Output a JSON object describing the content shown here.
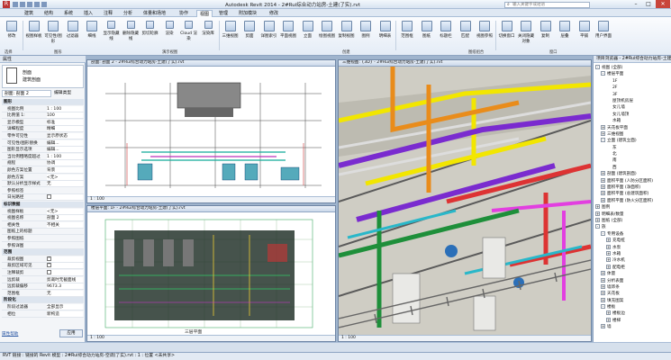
{
  "titlebar": {
    "title": "Autodesk Revit 2014 - 2#Rui综合动力站房-土建(了实).rvt",
    "search_placeholder": "输入关键字或短语",
    "minimize": "–",
    "maximize": "□",
    "close": "✕"
  },
  "tabs": [
    "建筑",
    "结构",
    "系统",
    "插入",
    "注释",
    "分析",
    "体量和场地",
    "协作",
    "视图",
    "管理",
    "附加模块",
    "修改"
  ],
  "active_tab": "视图",
  "ribbon": {
    "buttons": [
      {
        "label": "修改",
        "icon": "cursor-icon"
      },
      {
        "label": "视图样板",
        "icon": "template-icon"
      },
      {
        "label": "可见性/图形",
        "icon": "visibility-icon"
      },
      {
        "label": "过滤器",
        "icon": "filter-icon"
      },
      {
        "label": "细线",
        "icon": "thin-lines-icon"
      },
      {
        "label": "显示隐藏线",
        "icon": "show-hidden-icon"
      },
      {
        "label": "删除隐藏线",
        "icon": "remove-hidden-icon"
      },
      {
        "label": "剪切轮廓",
        "icon": "cut-profile-icon"
      },
      {
        "label": "渲染",
        "icon": "render-icon"
      },
      {
        "label": "Cloud 渲染",
        "icon": "cloud-icon"
      },
      {
        "label": "渲染库",
        "icon": "gallery-icon"
      },
      {
        "label": "三维视图",
        "icon": "3d-view-icon"
      },
      {
        "label": "剪面",
        "icon": "section-icon"
      },
      {
        "label": "详图索引",
        "icon": "callout-icon"
      },
      {
        "label": "平面视图",
        "icon": "plan-view-icon"
      },
      {
        "label": "立面",
        "icon": "elevation-icon"
      },
      {
        "label": "绘图视图",
        "icon": "drafting-icon"
      },
      {
        "label": "复制视图",
        "icon": "duplicate-icon"
      },
      {
        "label": "图例",
        "icon": "legend-icon"
      },
      {
        "label": "明细表",
        "icon": "schedule-icon"
      },
      {
        "label": "范围框",
        "icon": "scope-box-icon"
      },
      {
        "label": "图纸",
        "icon": "sheet-icon"
      },
      {
        "label": "标题栏",
        "icon": "titleblock-icon"
      },
      {
        "label": "匹配",
        "icon": "matchline-icon"
      },
      {
        "label": "视图参照",
        "icon": "view-reference-icon"
      },
      {
        "label": "切换窗口",
        "icon": "switch-window-icon"
      },
      {
        "label": "关闭隐藏对象",
        "icon": "close-hidden-icon"
      },
      {
        "label": "复制",
        "icon": "replicate-icon"
      },
      {
        "label": "层叠",
        "icon": "cascade-icon"
      },
      {
        "label": "平铺",
        "icon": "tile-icon"
      },
      {
        "label": "用户界面",
        "icon": "ui-icon"
      }
    ],
    "panels": [
      "选择",
      "图形",
      "演示视图",
      "创建",
      "图纸组合",
      "窗口"
    ]
  },
  "properties": {
    "header": "属性",
    "type_name": "剖面",
    "type_sub": "建筑剖面",
    "selector": "剖面: 剖面 2",
    "edit_type": "编辑类型",
    "help": "属性帮助",
    "apply": "应用",
    "rows": [
      {
        "group": true,
        "k": "图形"
      },
      {
        "k": "视图比例",
        "v": "1 : 100"
      },
      {
        "k": "比例值 1:",
        "v": "100"
      },
      {
        "k": "显示模型",
        "v": "标准"
      },
      {
        "k": "详细程度",
        "v": "精细"
      },
      {
        "k": "零件可见性",
        "v": "显示原状态"
      },
      {
        "k": "可见性/图形替换",
        "v": "编辑..."
      },
      {
        "k": "图形显示选项",
        "v": "编辑..."
      },
      {
        "k": "当比例粗略度超过",
        "v": "1 : 100"
      },
      {
        "k": "规程",
        "v": "协调"
      },
      {
        "k": "颜色方案位置",
        "v": "背景"
      },
      {
        "k": "颜色方案",
        "v": "<无>"
      },
      {
        "k": "默认分析显示样式",
        "v": "无"
      },
      {
        "k": "参照标签",
        "v": ""
      },
      {
        "k": "日光路径",
        "v": "",
        "check": false
      },
      {
        "group": true,
        "k": "标识数据"
      },
      {
        "k": "视图样板",
        "v": "<无>"
      },
      {
        "k": "视图名称",
        "v": "剖面 2"
      },
      {
        "k": "相关性",
        "v": "不相关"
      },
      {
        "k": "图纸上的标题",
        "v": ""
      },
      {
        "k": "参照图纸",
        "v": ""
      },
      {
        "k": "参照详图",
        "v": ""
      },
      {
        "group": true,
        "k": "范围"
      },
      {
        "k": "裁剪视图",
        "v": "",
        "check": true
      },
      {
        "k": "裁剪区域可见",
        "v": "",
        "check": true
      },
      {
        "k": "注释裁剪",
        "v": "",
        "check": false
      },
      {
        "k": "远剪裁",
        "v": "剪裁时无截面线"
      },
      {
        "k": "远剪裁偏移",
        "v": "9673.3"
      },
      {
        "k": "范围框",
        "v": "无"
      },
      {
        "group": true,
        "k": "阶段化"
      },
      {
        "k": "阶段过滤器",
        "v": "全部显示"
      },
      {
        "k": "相位",
        "v": "新构造"
      }
    ]
  },
  "views": {
    "section": {
      "title": "剖面: 剖面 2 - 2#Rui综合动力站房-土建(了实).rvt",
      "scale": "1 : 100"
    },
    "plan": {
      "title": "楼层平面: 1F - 2#Rui综合动力站房-土建(了实).rvt",
      "scale": "1 : 100",
      "label": "三层平面"
    },
    "view3d": {
      "title": "三维视图: {3D} - 2#Rui综合动力站房-土建(了实).rvt",
      "scale": "1 : 100"
    }
  },
  "browser": {
    "header": "项目浏览器 - 2#Rui综合动力站房-土建(了实).rvt",
    "items": [
      {
        "t": "视图 (全部)",
        "d": 0,
        "tw": "-"
      },
      {
        "t": "楼层平面",
        "d": 1,
        "tw": "-"
      },
      {
        "t": "1F",
        "d": 2
      },
      {
        "t": "2F",
        "d": 2
      },
      {
        "t": "3F",
        "d": 2
      },
      {
        "t": "屋顶机房层",
        "d": 2
      },
      {
        "t": "女儿墙",
        "d": 2
      },
      {
        "t": "女儿墙顶",
        "d": 2
      },
      {
        "t": "水箱",
        "d": 2
      },
      {
        "t": "天花板平面",
        "d": 1,
        "tw": "+"
      },
      {
        "t": "三维视图",
        "d": 1,
        "tw": "+"
      },
      {
        "t": "立面 (建筑立面)",
        "d": 1,
        "tw": "-"
      },
      {
        "t": "东",
        "d": 2
      },
      {
        "t": "北",
        "d": 2
      },
      {
        "t": "南",
        "d": 2
      },
      {
        "t": "西",
        "d": 2
      },
      {
        "t": "剖面 (建筑剖面)",
        "d": 1,
        "tw": "+"
      },
      {
        "t": "面积平面 (人防分区面积)",
        "d": 1,
        "tw": "+"
      },
      {
        "t": "面积平面 (净面积)",
        "d": 1,
        "tw": "+"
      },
      {
        "t": "面积平面 (总建筑面积)",
        "d": 1,
        "tw": "+"
      },
      {
        "t": "面积平面 (防火分区面积)",
        "d": 1,
        "tw": "+"
      },
      {
        "t": "图例",
        "d": 0,
        "tw": "+"
      },
      {
        "t": "明细表/数量",
        "d": 0,
        "tw": "+"
      },
      {
        "t": "图纸 (全部)",
        "d": 0,
        "tw": "+"
      },
      {
        "t": "族",
        "d": 0,
        "tw": "-"
      },
      {
        "t": "专用设备",
        "d": 1,
        "tw": "-"
      },
      {
        "t": "充电桩",
        "d": 2,
        "tw": "+"
      },
      {
        "t": "水泵",
        "d": 2,
        "tw": "+"
      },
      {
        "t": "水箱",
        "d": 2,
        "tw": "+"
      },
      {
        "t": "冷水机",
        "d": 2,
        "tw": "+"
      },
      {
        "t": "配电柜",
        "d": 2,
        "tw": "+"
      },
      {
        "t": "体量",
        "d": 1,
        "tw": "+"
      },
      {
        "t": "分析表面",
        "d": 1,
        "tw": "+"
      },
      {
        "t": "墙饰条",
        "d": 1,
        "tw": "+"
      },
      {
        "t": "天花板",
        "d": 1,
        "tw": "+"
      },
      {
        "t": "填充图案",
        "d": 1,
        "tw": "+"
      },
      {
        "t": "楼板",
        "d": 1,
        "tw": "-"
      },
      {
        "t": "楼板边",
        "d": 2,
        "tw": "+"
      },
      {
        "t": "楼梯",
        "d": 2,
        "tw": "+"
      },
      {
        "t": "墙",
        "d": 1,
        "tw": "+"
      }
    ]
  },
  "status": "RVT 链接 : 链接的 Revit 模型 : 2#Rui综合动力站房-空调(了实).rvt : 1 : 位置 <未共享>"
}
